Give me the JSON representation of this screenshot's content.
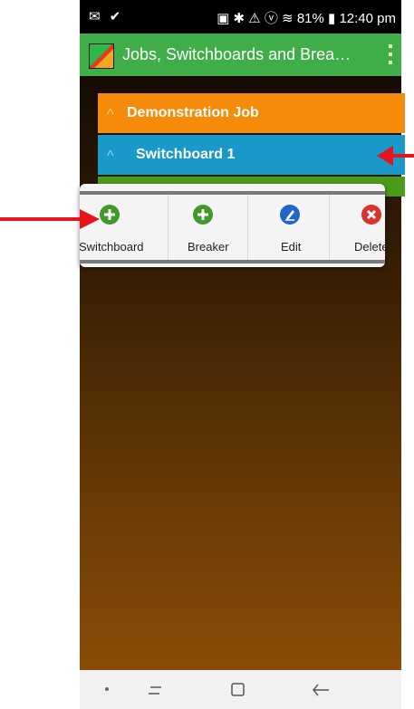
{
  "status_bar": {
    "time": "12:40 pm",
    "battery": "81%",
    "left_icons": "✉ ✔",
    "right_icons": "▣ ✱ ⚠ ⓥ ≋"
  },
  "app_bar": {
    "title": "Jobs, Switchboards and Brea…",
    "logo_icon": "power-logo-icon",
    "menu_icon": "overflow-menu-icon"
  },
  "tree": {
    "job_label": "Demonstration Job",
    "switchboard_label": "Switchboard 1",
    "chevron": "^"
  },
  "popup": {
    "actions": [
      {
        "label": "Switchboard",
        "icon": "add-icon"
      },
      {
        "label": "Breaker",
        "icon": "add-icon"
      },
      {
        "label": "Edit",
        "icon": "edit-icon"
      },
      {
        "label": "Delete",
        "icon": "delete-icon"
      }
    ]
  },
  "colors": {
    "app_bar": "#3fae49",
    "job_row": "#f58b08",
    "switchboard_row": "#1998c9",
    "arrow": "#e8141c"
  }
}
